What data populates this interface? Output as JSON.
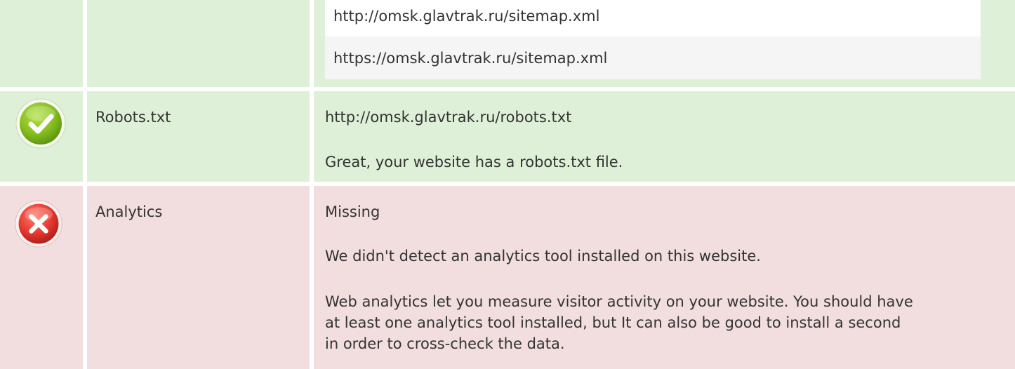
{
  "sitemap": {
    "urls": [
      "http://omsk.glavtrak.ru/sitemap.xml",
      "https://omsk.glavtrak.ru/sitemap.xml"
    ]
  },
  "robots": {
    "status": "pass",
    "status_icon": "check-circle-icon",
    "label": "Robots.txt",
    "url": "http://omsk.glavtrak.ru/robots.txt",
    "message": "Great, your website has a robots.txt file."
  },
  "analytics": {
    "status": "fail",
    "status_icon": "x-circle-icon",
    "label": "Analytics",
    "value": "Missing",
    "message": "We didn't detect an analytics tool installed on this website.",
    "advice": "Web analytics let you measure visitor activity on your website. You should have at least one analytics tool installed, but It can also be good to install a second in order to cross-check the data."
  },
  "colors": {
    "pass_background": "#dff0d8",
    "fail_background": "#f2dede",
    "pass_icon": "#7cb518",
    "fail_icon": "#e0322f"
  }
}
